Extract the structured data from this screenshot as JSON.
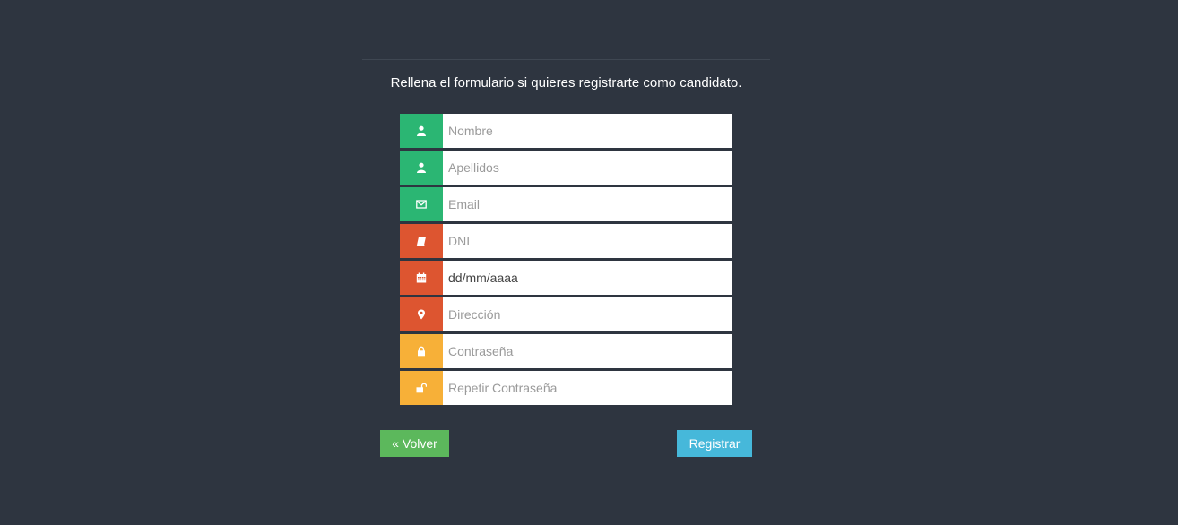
{
  "intro": "Rellena el formulario si quieres registrarte como candidato.",
  "fields": [
    {
      "icon": "user-icon",
      "color": "#2bb673",
      "placeholder": "Nombre",
      "value": ""
    },
    {
      "icon": "user-icon",
      "color": "#2bb673",
      "placeholder": "Apellidos",
      "value": ""
    },
    {
      "icon": "envelope-icon",
      "color": "#2bb673",
      "placeholder": "Email",
      "value": ""
    },
    {
      "icon": "id-card-icon",
      "color": "#dd5530",
      "placeholder": "DNI",
      "value": ""
    },
    {
      "icon": "calendar-icon",
      "color": "#dd5530",
      "placeholder": "",
      "value": "dd/mm/aaaa"
    },
    {
      "icon": "map-marker-icon",
      "color": "#dd5530",
      "placeholder": "Dirección",
      "value": ""
    },
    {
      "icon": "lock-icon",
      "color": "#f7b038",
      "placeholder": "Contraseña",
      "value": ""
    },
    {
      "icon": "unlock-icon",
      "color": "#f7b038",
      "placeholder": "Repetir Contraseña",
      "value": ""
    }
  ],
  "buttons": {
    "back_label": "« Volver",
    "back_color": "#5cb85c",
    "submit_label": "Registrar",
    "submit_color": "#46b8da"
  }
}
